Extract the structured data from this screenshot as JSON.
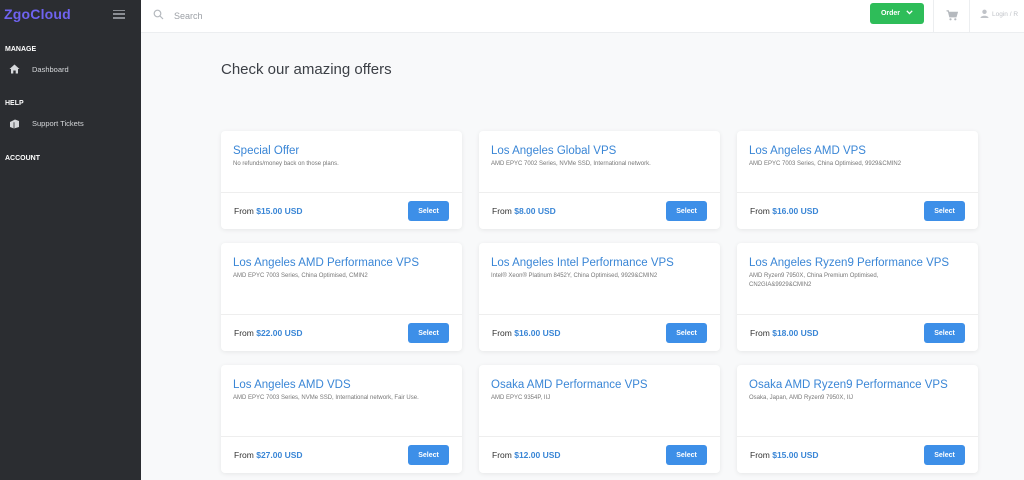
{
  "sidebar": {
    "brand": "ZgoCloud",
    "sections": {
      "manage": "MANAGE",
      "help": "HELP",
      "account": "ACCOUNT"
    },
    "items": {
      "dashboard": "Dashboard",
      "support": "Support Tickets"
    }
  },
  "topbar": {
    "search_placeholder": "Search",
    "order_label": "Order",
    "login_label": "Login / R"
  },
  "main": {
    "title": "Check our amazing offers"
  },
  "products": [
    {
      "name": "Special Offer",
      "desc": "No refunds/money back on those plans.",
      "from": "From",
      "price": "$15.00 USD",
      "select": "Select"
    },
    {
      "name": "Los Angeles Global VPS",
      "desc": "AMD EPYC 7002 Series, NVMe SSD, International network.",
      "from": "From",
      "price": "$8.00 USD",
      "select": "Select"
    },
    {
      "name": "Los Angeles AMD VPS",
      "desc": "AMD EPYC 7003 Series, China Optimised, 9929&CMIN2",
      "from": "From",
      "price": "$16.00 USD",
      "select": "Select"
    },
    {
      "name": "Los Angeles AMD Performance VPS",
      "desc": "AMD EPYC 7003 Series, China Optimised, CMIN2",
      "from": "From",
      "price": "$22.00 USD",
      "select": "Select"
    },
    {
      "name": "Los Angeles Intel Performance VPS",
      "desc": "Intel® Xeon® Platinum 8452Y, China Optimised, 9929&CMIN2",
      "from": "From",
      "price": "$16.00 USD",
      "select": "Select"
    },
    {
      "name": "Los Angeles Ryzen9 Performance VPS",
      "desc": "AMD Ryzen9 7950X, China Premium Optimised, CN2GIA&9929&CMIN2",
      "from": "From",
      "price": "$18.00 USD",
      "select": "Select"
    },
    {
      "name": "Los Angeles AMD VDS",
      "desc": "AMD EPYC 7003 Series, NVMe SSD, International network, Fair Use.",
      "from": "From",
      "price": "$27.00 USD",
      "select": "Select"
    },
    {
      "name": "Osaka AMD Performance VPS",
      "desc": "AMD EPYC 9354P, IIJ",
      "from": "From",
      "price": "$12.00 USD",
      "select": "Select"
    },
    {
      "name": "Osaka AMD Ryzen9 Performance VPS",
      "desc": "Osaka, Japan, AMD Ryzen9 7950X, IIJ",
      "from": "From",
      "price": "$15.00 USD",
      "select": "Select"
    }
  ],
  "colors": {
    "sidebar_bg": "#2b2d31",
    "brand": "#6f63f0",
    "accent": "#3a86d6",
    "select_button": "#3d8fe8",
    "order_button": "#2ebd59"
  },
  "icons": {
    "menu": "hamburger-icon",
    "search": "search-icon",
    "dashboard": "home-icon",
    "support": "tickets-icon",
    "order_caret": "chevron-down-icon",
    "cart": "cart-icon",
    "login": "user-icon"
  }
}
